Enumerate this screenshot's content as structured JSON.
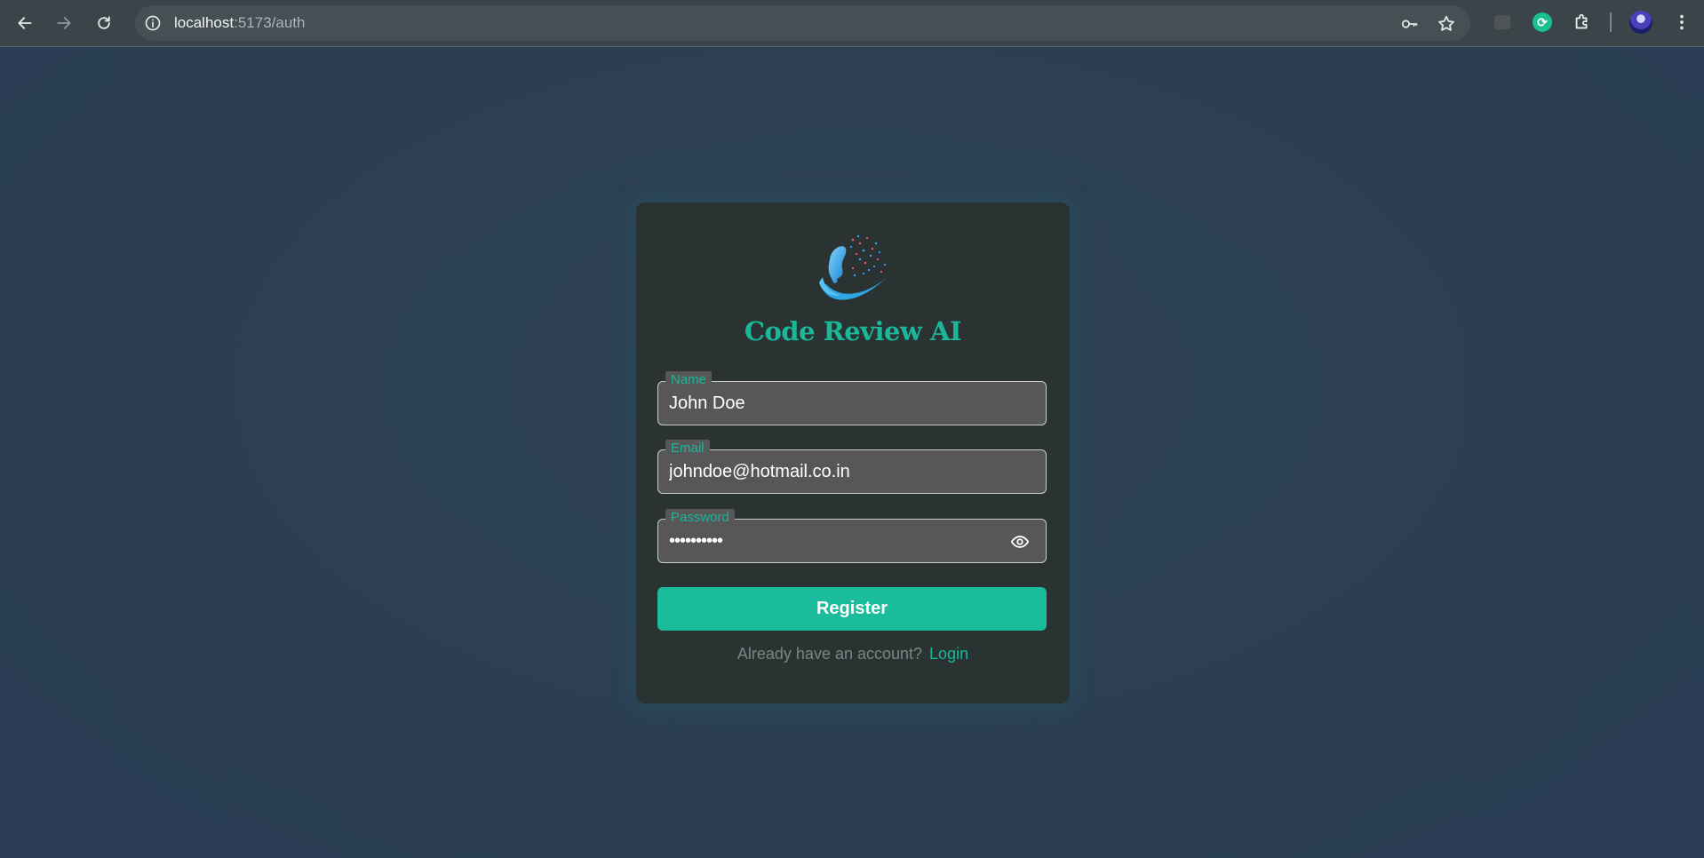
{
  "browser": {
    "url_host": "localhost",
    "url_path": ":5173/auth",
    "icons": [
      "back-icon",
      "forward-icon",
      "reload-icon",
      "info-icon",
      "key-icon",
      "star-icon",
      "extension-icon",
      "puzzle-icon",
      "avatar",
      "kebab-menu-icon"
    ]
  },
  "app": {
    "brand_name": "Code Review AI"
  },
  "form": {
    "name": {
      "label": "Name",
      "value": "John Doe"
    },
    "email": {
      "label": "Email",
      "value": "johndoe@hotmail.co.in"
    },
    "password": {
      "label": "Password",
      "value": "••••••••••"
    },
    "submit_label": "Register",
    "footer_text": "Already have an account?",
    "login_link": "Login"
  },
  "colors": {
    "accent": "#1ab79a",
    "button": "#1bbc9c",
    "card": "#2b3332",
    "page": "#2b3e54"
  }
}
